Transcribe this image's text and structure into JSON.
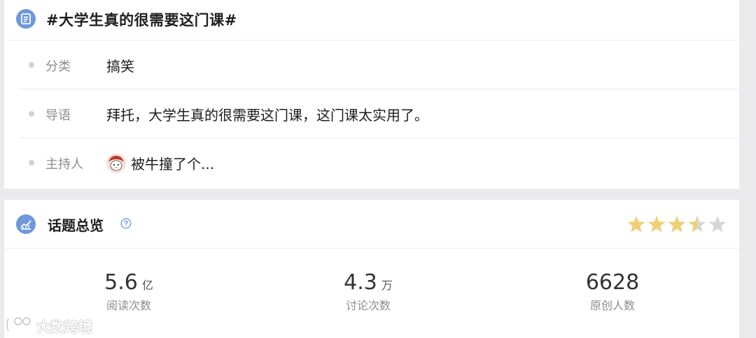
{
  "topic": {
    "title": "#大学生真的很需要这门课#",
    "rows": [
      {
        "label": "分类",
        "value": "搞笑"
      },
      {
        "label": "导语",
        "value": "拜托，大学生真的很需要这门课，这门课太实用了。"
      },
      {
        "label": "主持人",
        "value": "被牛撞了个..."
      }
    ]
  },
  "overview": {
    "title": "话题总览",
    "rating": 3.5,
    "rating_max": 5,
    "stats": [
      {
        "value": "5.6",
        "unit": "亿",
        "label": "阅读次数"
      },
      {
        "value": "4.3",
        "unit": "万",
        "label": "讨论次数"
      },
      {
        "value": "6628",
        "unit": "",
        "label": "原创人数"
      }
    ]
  },
  "watermark": "大数跨境",
  "colors": {
    "accent": "#6e97dc",
    "star_filled": "#f1cf74",
    "star_empty": "#d6d6d6"
  },
  "icons": {
    "topic": "list-document-icon",
    "overview": "trend-chart-icon",
    "help": "question-circle-icon"
  }
}
